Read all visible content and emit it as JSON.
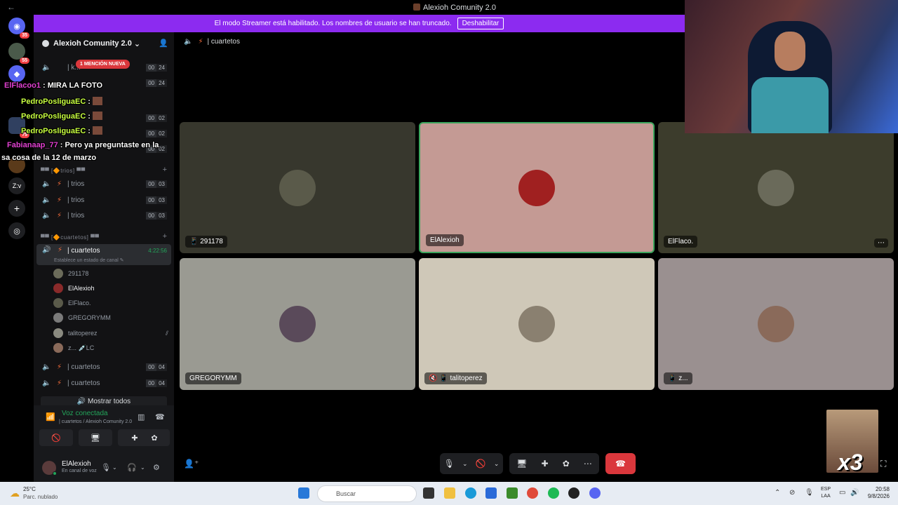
{
  "window": {
    "title": "Alexioh Comunity 2.0",
    "back": "←"
  },
  "banner": {
    "text": "El modo Streamer está habilitado. Los nombres de usuario se han truncado.",
    "button": "Deshabilitar"
  },
  "rail": {
    "badges": [
      "35",
      "55",
      "75"
    ]
  },
  "guild": {
    "name": "Alexioh Comunity 2.0",
    "chevron": "⌄"
  },
  "mention": "1 MENCIÓN NUEVA",
  "channels_top": [
    {
      "name": "| k...",
      "a": "00",
      "b": "24"
    },
    {
      "name": "",
      "a": "00",
      "b": "24"
    },
    {
      "name": "",
      "a": "00",
      "b": "02"
    },
    {
      "name": "",
      "a": "00",
      "b": "02"
    },
    {
      "name": "",
      "a": "00",
      "b": "02"
    }
  ],
  "category_trios": "▀▀ [🔶trios] ▀▀",
  "trios": [
    {
      "name": "| trios",
      "a": "00",
      "b": "03"
    },
    {
      "name": "| trios",
      "a": "00",
      "b": "03"
    },
    {
      "name": "| trios",
      "a": "00",
      "b": "03"
    }
  ],
  "category_cuartetos": "▀▀ [🔶cuartetos] ▀▀",
  "active_channel": {
    "name": "| cuartetos",
    "time": "4:22:56",
    "status": "Establece un estado de canal ✎"
  },
  "voice_users": [
    {
      "name": "291178",
      "color": "#6b6b5a"
    },
    {
      "name": "ElAlexioh",
      "color": "#8a2a2a"
    },
    {
      "name": "ElFlaco.",
      "color": "#5a5a4a"
    },
    {
      "name": "GREGORYMM",
      "color": "#7a7a7a"
    },
    {
      "name": "talitoperez",
      "color": "#8a8a80"
    },
    {
      "name": "z... 💉LC",
      "color": "#8a6a5a"
    }
  ],
  "cuartetos_more": [
    {
      "name": "| cuartetos",
      "a": "00",
      "b": "04"
    },
    {
      "name": "| cuartetos",
      "a": "00",
      "b": "04"
    }
  ],
  "show_all": "🔊 Mostrar todos",
  "voice": {
    "title": "Voz conectada",
    "sub": "| cuartetos / Alexioh Comunity 2.0"
  },
  "user": {
    "name": "ElAlexioh",
    "status": "En canal de voz"
  },
  "header": {
    "channel": "| cuartetos"
  },
  "tiles": [
    {
      "label": "📱 291178",
      "bg": "#37372d",
      "av": "#5a5a4a"
    },
    {
      "label": "ElAlexioh",
      "bg": "#c49a94",
      "av": "#a02020"
    },
    {
      "label": "ElFlaco.",
      "bg": "#3c3c2c",
      "av": "#6a6a5a"
    },
    {
      "label": "GREGORYMM",
      "bg": "#9a9a92",
      "av": "#5a4a5a"
    },
    {
      "label": "🔇 📱 talitoperez",
      "bg": "#cfc8b8",
      "av": "#8a8070"
    },
    {
      "label": "📱 z...",
      "bg": "#9a9090",
      "av": "#8a6a5a"
    }
  ],
  "chat": [
    {
      "user": "ElFlacoo1",
      "color": "#e040d0",
      "text": ": MIRA LA FOTO"
    },
    {
      "user": "PedroPosliguaEC",
      "color": "#c8ff40",
      "text": ":"
    },
    {
      "user": "PedroPosliguaEC",
      "color": "#c8ff40",
      "text": ":"
    },
    {
      "user": "PedroPosliguaEC",
      "color": "#c8ff40",
      "text": ":"
    },
    {
      "user": "Fabianaap_77",
      "color": "#e040d0",
      "text": ": Pero ya preguntaste en la"
    },
    {
      "user": "",
      "color": "#fff",
      "text": "sa cosa de la 12 de marzo"
    }
  ],
  "reaction": "x3",
  "taskbar": {
    "temp": "25°C",
    "weather": "Parc. nublado",
    "search": "Buscar",
    "lang1": "ESP",
    "lang2": "LAA",
    "time": "20:58",
    "date": "9/8/2026"
  }
}
